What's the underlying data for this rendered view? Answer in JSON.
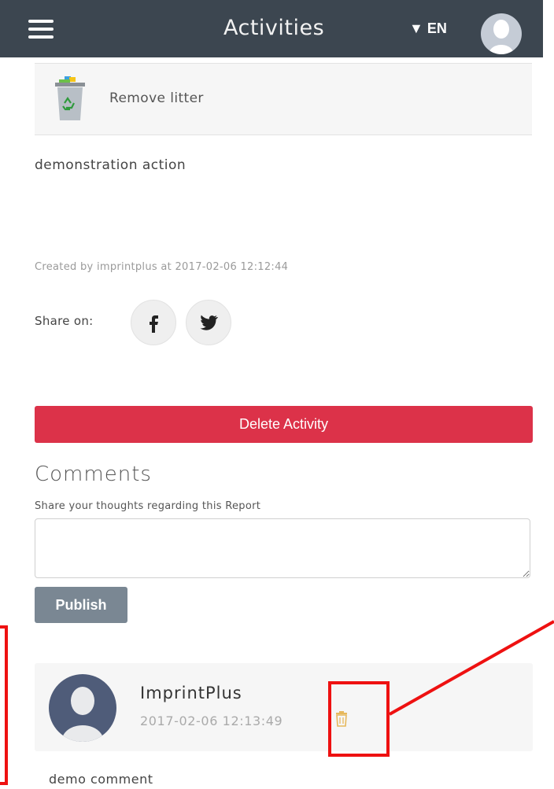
{
  "header": {
    "title": "Activities",
    "language": "▼ EN",
    "menu_icon": "hamburger-icon",
    "avatar_icon": "user-avatar-icon"
  },
  "activity": {
    "category_icon": "recycle-bin-icon",
    "category": "Remove litter",
    "description": "demonstration action",
    "created": "Created by imprintplus at 2017-02-06 12:12:44",
    "share_label": "Share on:",
    "share_icons": [
      "facebook-icon",
      "twitter-icon"
    ],
    "delete_label": "Delete Activity"
  },
  "comments": {
    "title": "Comments",
    "prompt": "Share your thoughts regarding this Report",
    "input_value": "",
    "publish_label": "Publish",
    "items": [
      {
        "author": "ImprintPlus",
        "date": "2017-02-06 12:13:49",
        "text": "demo comment",
        "delete_icon": "trash-icon"
      }
    ]
  },
  "colors": {
    "topbar": "#3c4650",
    "delete_button": "#dc3249",
    "publish_button": "#7a8793",
    "annotation": "#ee1111"
  }
}
